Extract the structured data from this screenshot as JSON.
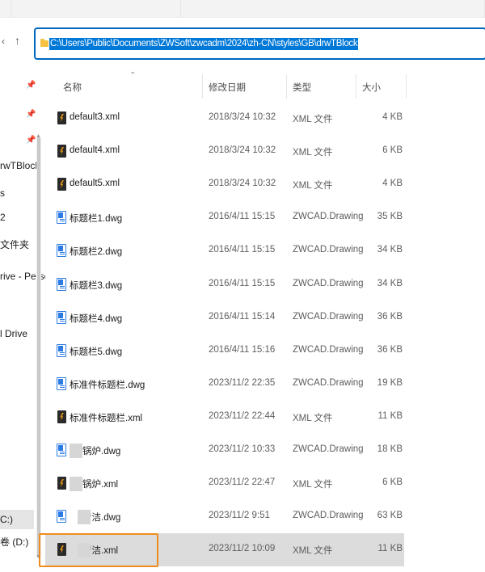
{
  "address_bar": {
    "path": "C:\\Users\\Public\\Documents\\ZWSoft\\zwcadm\\2024\\zh-CN\\styles\\GB\\drwTBlock"
  },
  "nav": {
    "back_icon": "chevron-left-icon",
    "up_icon": "arrow-up-icon"
  },
  "sidebar": {
    "items": [
      "rwTBlock",
      "s",
      "2",
      "文件夹",
      "rive - Persc",
      "l Drive",
      "C:)",
      "卷 (D:)"
    ]
  },
  "columns": {
    "name": "名称",
    "modified": "修改日期",
    "type": "类型",
    "size": "大小"
  },
  "files": [
    {
      "name": "default3.xml",
      "modified": "2018/3/24 10:32",
      "type": "XML 文件",
      "size": "4 KB",
      "icon": "xml"
    },
    {
      "name": "default4.xml",
      "modified": "2018/3/24 10:32",
      "type": "XML 文件",
      "size": "6 KB",
      "icon": "xml"
    },
    {
      "name": "default5.xml",
      "modified": "2018/3/24 10:32",
      "type": "XML 文件",
      "size": "4 KB",
      "icon": "xml"
    },
    {
      "name": "标题栏1.dwg",
      "modified": "2016/4/11 15:15",
      "type": "ZWCAD.Drawing",
      "size": "35 KB",
      "icon": "dwg"
    },
    {
      "name": "标题栏2.dwg",
      "modified": "2016/4/11 15:15",
      "type": "ZWCAD.Drawing",
      "size": "34 KB",
      "icon": "dwg"
    },
    {
      "name": "标题栏3.dwg",
      "modified": "2016/4/11 15:15",
      "type": "ZWCAD.Drawing",
      "size": "34 KB",
      "icon": "dwg"
    },
    {
      "name": "标题栏4.dwg",
      "modified": "2016/4/11 15:14",
      "type": "ZWCAD.Drawing",
      "size": "36 KB",
      "icon": "dwg"
    },
    {
      "name": "标题栏5.dwg",
      "modified": "2016/4/11 15:16",
      "type": "ZWCAD.Drawing",
      "size": "36 KB",
      "icon": "dwg"
    },
    {
      "name": "标准件标题栏.dwg",
      "modified": "2023/11/2 22:35",
      "type": "ZWCAD.Drawing",
      "size": "19 KB",
      "icon": "dwg"
    },
    {
      "name": "标准件标题栏.xml",
      "modified": "2023/11/2 22:44",
      "type": "XML 文件",
      "size": "11 KB",
      "icon": "xml"
    },
    {
      "name": "锅炉.dwg",
      "modified": "2023/11/2 10:33",
      "type": "ZWCAD.Drawing",
      "size": "18 KB",
      "icon": "dwg"
    },
    {
      "name": "锅炉.xml",
      "modified": "2023/11/2 22:47",
      "type": "XML 文件",
      "size": "6 KB",
      "icon": "xml"
    },
    {
      "name": "清洁.dwg",
      "modified": "2023/11/2 9:51",
      "type": "ZWCAD.Drawing",
      "size": "63 KB",
      "icon": "dwg"
    },
    {
      "name": "清洁.xml",
      "modified": "2023/11/2 10:09",
      "type": "XML 文件",
      "size": "11 KB",
      "icon": "xml"
    }
  ],
  "colors": {
    "accent": "#0078d7",
    "highlight_border": "#f08c1e",
    "selected_row": "#dcdcdc"
  }
}
